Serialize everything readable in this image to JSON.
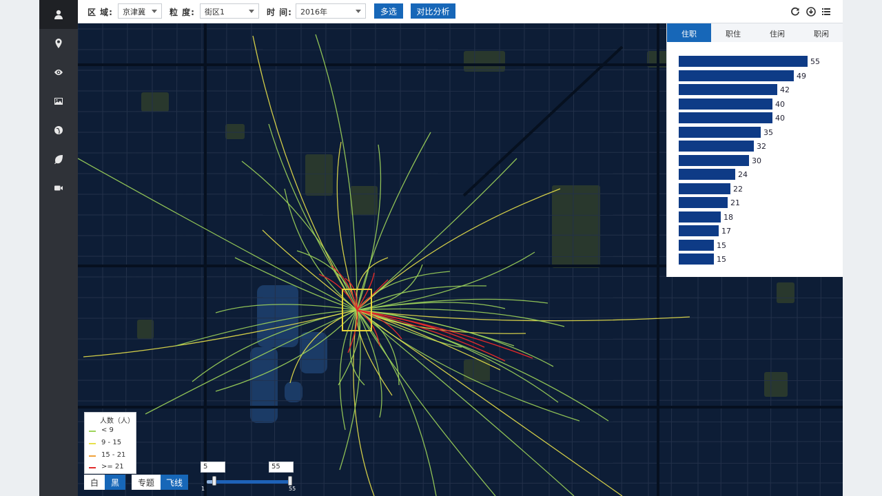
{
  "sidebar": {
    "items": [
      {
        "icon": "user-icon",
        "active": true
      },
      {
        "icon": "location-pin-icon",
        "active": false
      },
      {
        "icon": "eye-icon",
        "active": false
      },
      {
        "icon": "image-icon",
        "active": false
      },
      {
        "icon": "globe-icon",
        "active": false
      },
      {
        "icon": "leaf-icon",
        "active": false
      },
      {
        "icon": "video-camera-icon",
        "active": false
      }
    ]
  },
  "toolbar": {
    "region_label": "区 域:",
    "region_value": "京津冀",
    "granularity_label": "粒 度:",
    "granularity_value": "街区1",
    "time_label": "时 间:",
    "time_value": "2016年",
    "multi_select_label": "多选",
    "compare_label": "对比分析",
    "tools": [
      "refresh-icon",
      "download-icon",
      "list-icon"
    ]
  },
  "panel": {
    "tabs": [
      {
        "label": "住职",
        "active": true
      },
      {
        "label": "职住",
        "active": false
      },
      {
        "label": "住闲",
        "active": false
      },
      {
        "label": "职闲",
        "active": false
      }
    ],
    "max_value": 55
  },
  "chart_data": {
    "type": "bar",
    "orientation": "horizontal",
    "values": [
      55,
      49,
      42,
      40,
      40,
      35,
      32,
      30,
      24,
      22,
      21,
      18,
      17,
      15,
      15
    ],
    "color": "#0e3b86"
  },
  "legend": {
    "title": "人数（人）",
    "items": [
      {
        "label": "< 9",
        "color": "#9dd45a"
      },
      {
        "label": "9 - 15",
        "color": "#e7e04a"
      },
      {
        "label": "15 - 21",
        "color": "#f0a23a"
      },
      {
        "label": ">= 21",
        "color": "#e02a2a"
      }
    ]
  },
  "toggles": {
    "white_label": "白",
    "black_label": "黑",
    "theme_label": "专题",
    "flyline_label": "飞线"
  },
  "range": {
    "min_input": "5",
    "max_input": "55",
    "min_tick": "1",
    "max_tick": "55",
    "low": 5,
    "high": 55,
    "scale_max": 55
  },
  "colors": {
    "accent": "#1767b8",
    "map_bg": "#0d1d36",
    "flow_low": "#9dd45a",
    "flow_mid": "#e7e04a",
    "flow_high": "#e02a2a"
  }
}
